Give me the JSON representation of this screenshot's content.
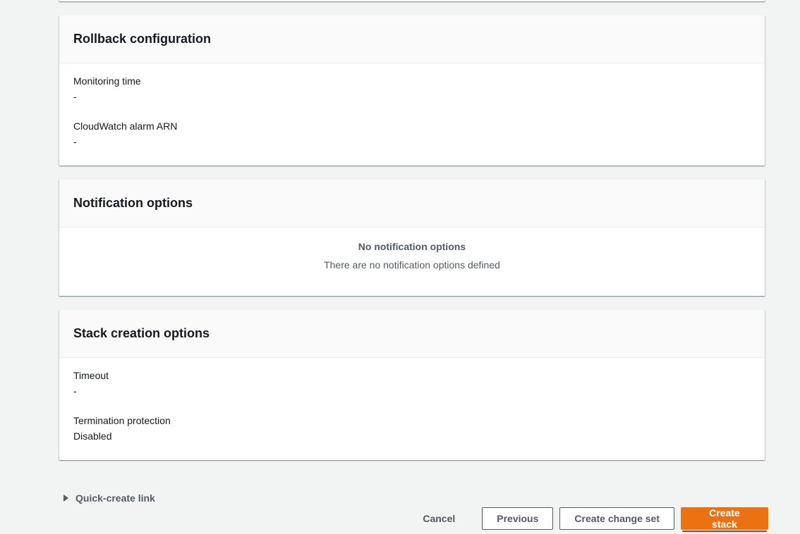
{
  "rollback": {
    "title": "Rollback configuration",
    "fields": [
      {
        "label": "Monitoring time",
        "value": "-"
      },
      {
        "label": "CloudWatch alarm ARN",
        "value": "-"
      }
    ]
  },
  "notifications": {
    "title": "Notification options",
    "empty_title": "No notification options",
    "empty_description": "There are no notification options defined"
  },
  "stack_creation": {
    "title": "Stack creation options",
    "fields": [
      {
        "label": "Timeout",
        "value": "-"
      },
      {
        "label": "Termination protection",
        "value": "Disabled"
      }
    ]
  },
  "quick_create": {
    "label": "Quick-create link",
    "icon": "caret-right-icon"
  },
  "actions": {
    "cancel": "Cancel",
    "previous": "Previous",
    "create_change_set": "Create change set",
    "create_stack": "Create stack"
  },
  "colors": {
    "primary": "#ec7211",
    "focus": "#d13212",
    "background": "#f2f3f3"
  }
}
